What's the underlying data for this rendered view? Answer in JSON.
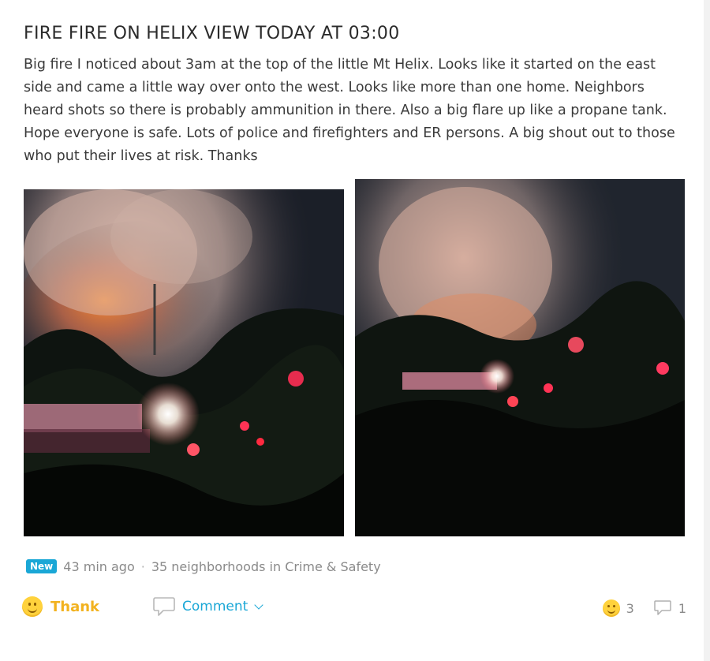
{
  "post": {
    "title": "FIRE FIRE ON HELIX VIEW TODAY AT 03:00",
    "body": "Big fire I noticed about 3am at the top of the little Mt Helix. Looks like it started on the east side and came a little way over onto the west. Looks like more than one home. Neighbors heard shots so there is probably ammunition in there. Also a big flare up like a propane tank. Hope everyone is safe. Lots of police and firefighters and ER persons. A big shout out to those who put their lives at risk. Thanks"
  },
  "meta": {
    "badge": "New",
    "time_ago": "43 min ago",
    "separator": "·",
    "audience": "35 neighborhoods in Crime & Safety"
  },
  "actions": {
    "thank_label": "Thank",
    "comment_label": "Comment",
    "thank_count": "3",
    "comment_count": "1"
  },
  "icons": {
    "thank": "smiley-face-icon",
    "comment": "speech-bubble-icon",
    "dropdown": "chevron-down-icon",
    "reaction": "smiley-face-icon",
    "comment_count": "speech-bubble-icon"
  },
  "colors": {
    "accent_blue": "#1aa7d6",
    "thank_yellow": "#f2b21f",
    "muted_text": "#8a8a8a"
  }
}
